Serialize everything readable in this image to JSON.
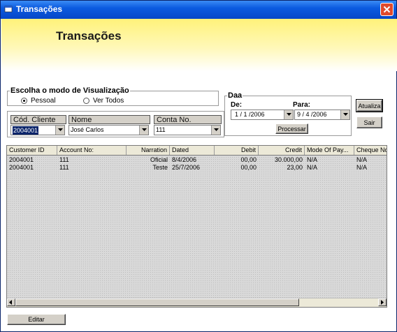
{
  "window": {
    "title": "Transações"
  },
  "banner": {
    "title": "Transações"
  },
  "view_mode": {
    "legend": "Escolha o modo de Visualização",
    "options": [
      {
        "label": "Pessoal",
        "selected": true
      },
      {
        "label": "Ver Todos",
        "selected": false
      }
    ]
  },
  "filters": {
    "client_code": {
      "label": "Cód. Cliente",
      "value": "2004001"
    },
    "name": {
      "label": "Nome",
      "value": "José Carlos"
    },
    "account": {
      "label": "Conta No.",
      "value": "111"
    }
  },
  "date_group": {
    "legend": "Daa",
    "from_label": "De:",
    "to_label": "Para:",
    "from_value": "1 / 1 /2006",
    "to_value": "9 / 4 /2006",
    "process_label": "Processar"
  },
  "buttons": {
    "update": "Atualiza",
    "exit": "Sair",
    "edit": "Editar"
  },
  "table": {
    "columns": [
      "Customer ID",
      "Account No:",
      "Narration",
      "Dated",
      "Debit",
      "Credit",
      "Mode Of Pay...",
      "Cheque No."
    ],
    "rows": [
      [
        "2004001",
        "111",
        "Oficial",
        "8/4/2006",
        "00,00",
        "30.000,00",
        "N/A",
        "N/A"
      ],
      [
        "2004001",
        "111",
        "Teste",
        "25/7/2006",
        "00,00",
        "23,00",
        "N/A",
        "N/A"
      ]
    ]
  },
  "colors": {
    "title_bar": "#0b5be0",
    "banner_top": "#fff27a",
    "grid_bg": "#d9d9d9",
    "close_button": "#e04a2c"
  }
}
